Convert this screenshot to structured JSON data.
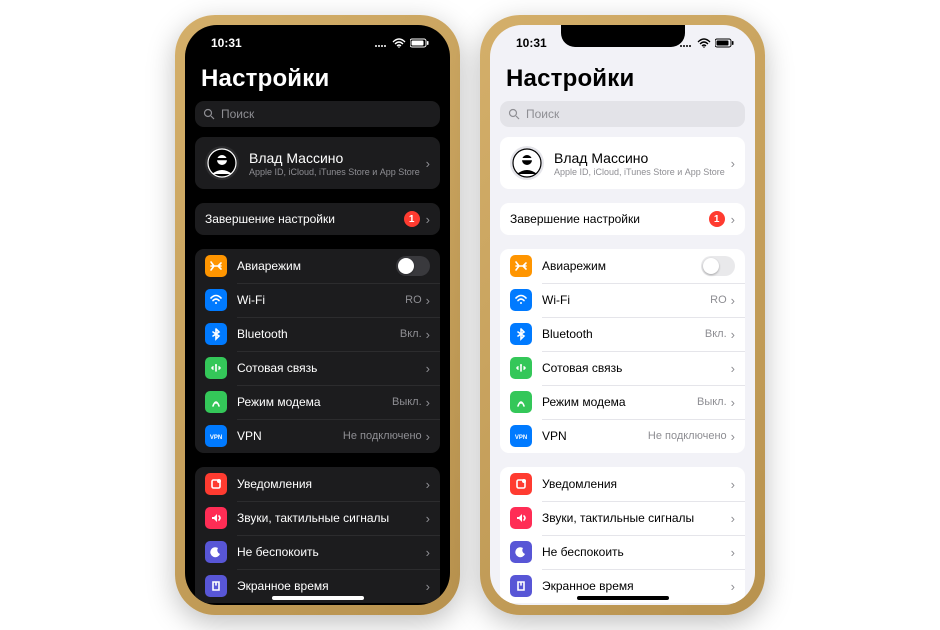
{
  "status": {
    "time": "10:31"
  },
  "title": "Настройки",
  "search": {
    "placeholder": "Поиск"
  },
  "account": {
    "name": "Влад Массино",
    "sub": "Apple ID, iCloud, iTunes Store и App Store"
  },
  "setup": {
    "label": "Завершение настройки",
    "badge": "1"
  },
  "network": [
    {
      "icon": "airplane",
      "color": "#ff9500",
      "label": "Авиарежим",
      "toggle": true
    },
    {
      "icon": "wifi",
      "color": "#007aff",
      "label": "Wi-Fi",
      "value": "RO"
    },
    {
      "icon": "bluetooth",
      "color": "#007aff",
      "label": "Bluetooth",
      "value": "Вкл."
    },
    {
      "icon": "cellular",
      "color": "#34c759",
      "label": "Сотовая связь",
      "value": ""
    },
    {
      "icon": "hotspot",
      "color": "#34c759",
      "label": "Режим модема",
      "value": "Выкл."
    },
    {
      "icon": "vpn",
      "color": "#007aff",
      "label": "VPN",
      "value": "Не подключено"
    }
  ],
  "general": [
    {
      "icon": "notify",
      "color": "#ff3b30",
      "label": "Уведомления"
    },
    {
      "icon": "sounds",
      "color": "#ff2d55",
      "label": "Звуки, тактильные сигналы"
    },
    {
      "icon": "dnd",
      "color": "#5856d6",
      "label": "Не беспокоить"
    },
    {
      "icon": "screentime",
      "color": "#5856d6",
      "label": "Экранное время"
    }
  ]
}
